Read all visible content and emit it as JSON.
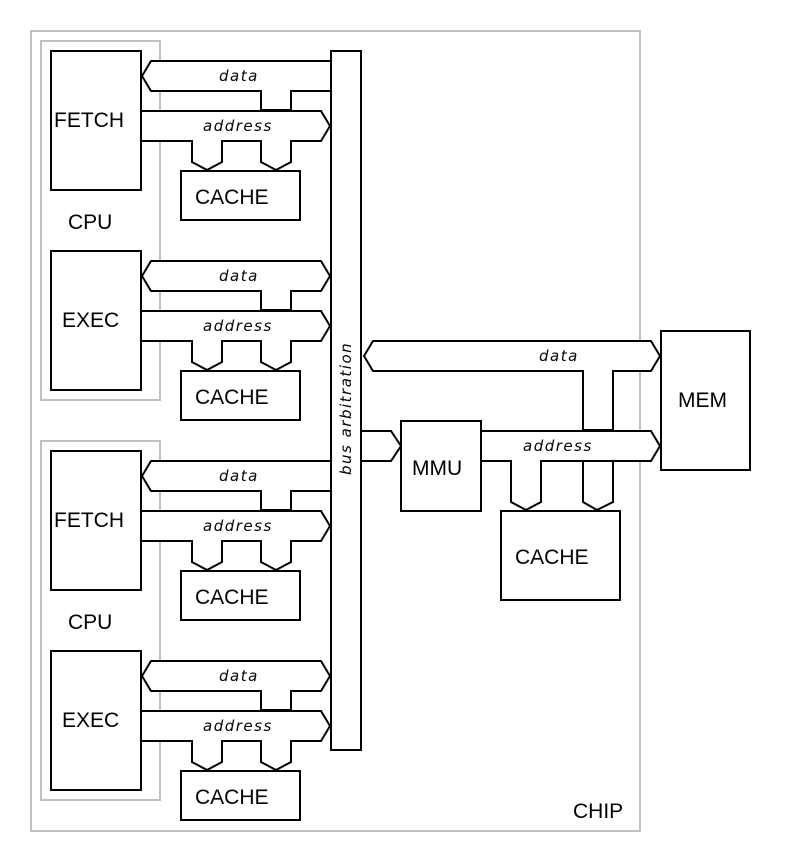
{
  "diagram": {
    "chip_label": "CHIP",
    "bus_arbitration_label": "bus arbitration",
    "cpus": [
      {
        "label": "CPU",
        "units": [
          {
            "name": "FETCH",
            "cache": "CACHE",
            "data_bus": "data",
            "address_bus": "address",
            "data_direction": "from-arbiter"
          },
          {
            "name": "EXEC",
            "cache": "CACHE",
            "data_bus": "data",
            "address_bus": "address",
            "data_direction": "bidirectional"
          }
        ]
      },
      {
        "label": "CPU",
        "units": [
          {
            "name": "FETCH",
            "cache": "CACHE",
            "data_bus": "data",
            "address_bus": "address",
            "data_direction": "from-arbiter"
          },
          {
            "name": "EXEC",
            "cache": "CACHE",
            "data_bus": "data",
            "address_bus": "address",
            "data_direction": "bidirectional"
          }
        ]
      }
    ],
    "mmu": {
      "label": "MMU"
    },
    "memory": {
      "label": "MEM"
    },
    "shared_cache": {
      "label": "CACHE"
    },
    "memory_data_bus": "data",
    "memory_address_bus": "address",
    "colors": {
      "stroke": "#000000",
      "outline": "#c0c0c0",
      "background": "#ffffff"
    }
  }
}
